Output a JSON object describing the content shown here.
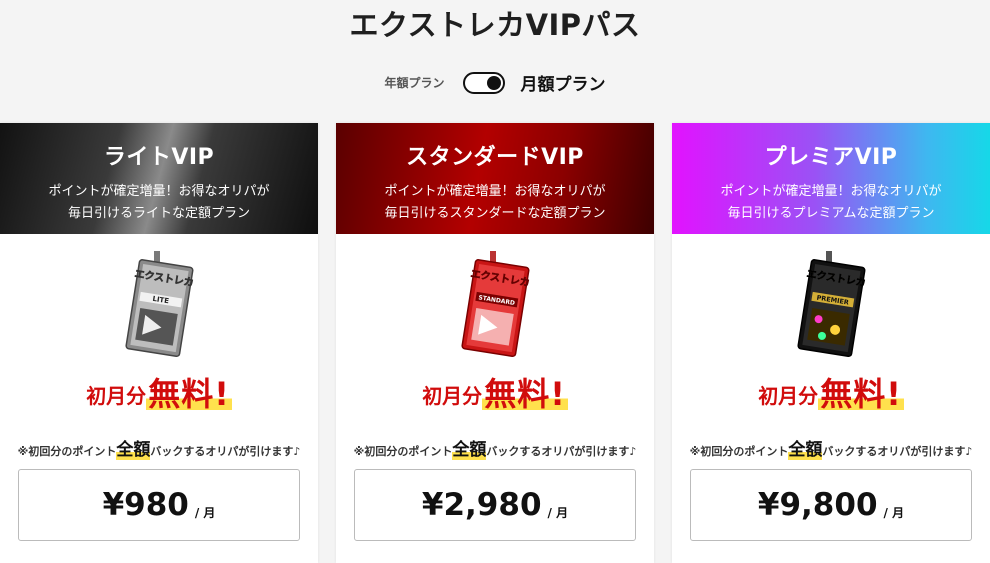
{
  "page": {
    "title": "エクストレカVIPパス"
  },
  "billing_toggle": {
    "yearly_label": "年額プラン",
    "monthly_label": "月額プラン",
    "selected": "monthly"
  },
  "plans": [
    {
      "name": "ライトVIP",
      "desc_line1": "ポイントが確定増量！お得なオリパが",
      "desc_line2": "毎日引けるライトな定額プラン",
      "card_logo": "エクストレカ",
      "card_tier": "LITE",
      "promo_first": "初月分",
      "promo_free": "無料!",
      "note_pre": "※初回分のポイント",
      "note_strong": "全額",
      "note_post": "バックするオリパが引けます♪",
      "price": "¥980",
      "unit": "/ 月",
      "colors": {
        "header": "#2a2a2a",
        "card": "#6e6e6e"
      }
    },
    {
      "name": "スタンダードVIP",
      "desc_line1": "ポイントが確定増量！お得なオリパが",
      "desc_line2": "毎日引けるスタンダードな定額プラン",
      "card_logo": "エクストレカ",
      "card_tier": "STANDARD",
      "promo_first": "初月分",
      "promo_free": "無料!",
      "note_pre": "※初回分のポイント",
      "note_strong": "全額",
      "note_post": "バックするオリパが引けます♪",
      "price": "¥2,980",
      "unit": "/ 月",
      "colors": {
        "header": "#a00000",
        "card": "#d71a1a"
      }
    },
    {
      "name": "プレミアVIP",
      "desc_line1": "ポイントが確定増量！お得なオリパが",
      "desc_line2": "毎日引けるプレミアムな定額プラン",
      "card_logo": "エクストレカ",
      "card_tier": "PREMIER",
      "promo_first": "初月分",
      "promo_free": "無料!",
      "note_pre": "※初回分のポイント",
      "note_strong": "全額",
      "note_post": "バックするオリパが引けます♪",
      "price": "¥9,800",
      "unit": "/ 月",
      "colors": {
        "header": "#b040f5",
        "card": "#1a1a1a"
      }
    }
  ],
  "colors": {
    "promo_red": "#d10c0c",
    "highlight_yellow": "#ffe14d"
  }
}
